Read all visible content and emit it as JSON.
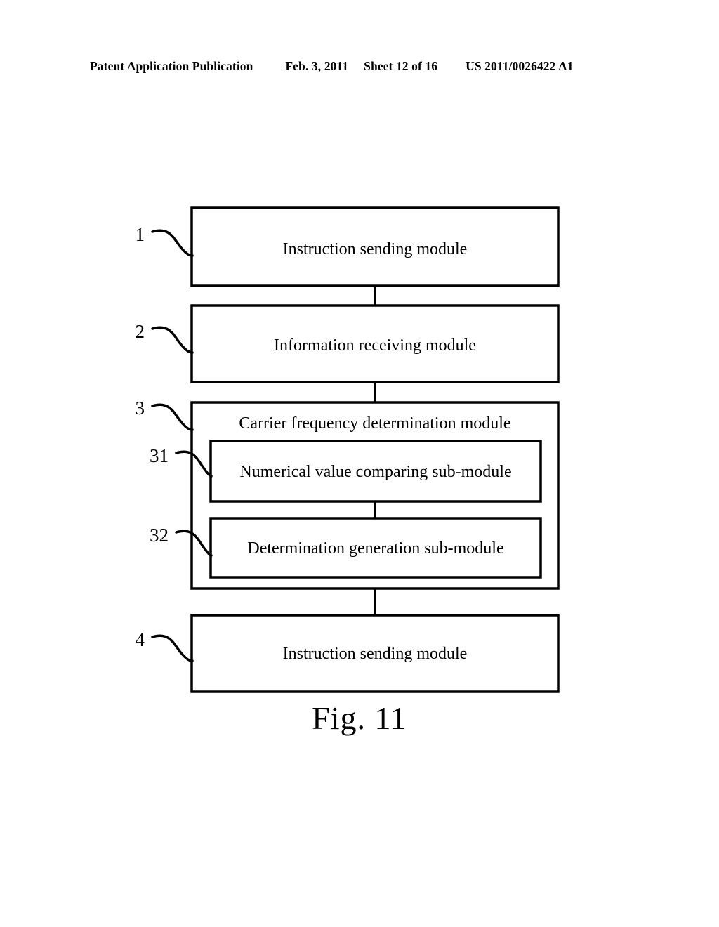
{
  "header": {
    "publication": "Patent Application Publication",
    "date": "Feb. 3, 2011",
    "sheet": "Sheet 12 of 16",
    "doc_number": "US 2011/0026422 A1"
  },
  "figure": {
    "caption": "Fig. 11",
    "line_color": "#000000",
    "background_color": "#ffffff",
    "blocks": [
      {
        "ref": "1",
        "label": "Instruction sending module",
        "level": "top"
      },
      {
        "ref": "2",
        "label": "Information receiving module",
        "level": "top"
      },
      {
        "ref": "3",
        "label": "Carrier frequency determination module",
        "level": "top",
        "children": [
          {
            "ref": "31",
            "label": "Numerical value comparing sub-module"
          },
          {
            "ref": "32",
            "label": "Determination generation sub-module"
          }
        ]
      },
      {
        "ref": "4",
        "label": "Instruction sending module",
        "level": "top"
      }
    ]
  }
}
